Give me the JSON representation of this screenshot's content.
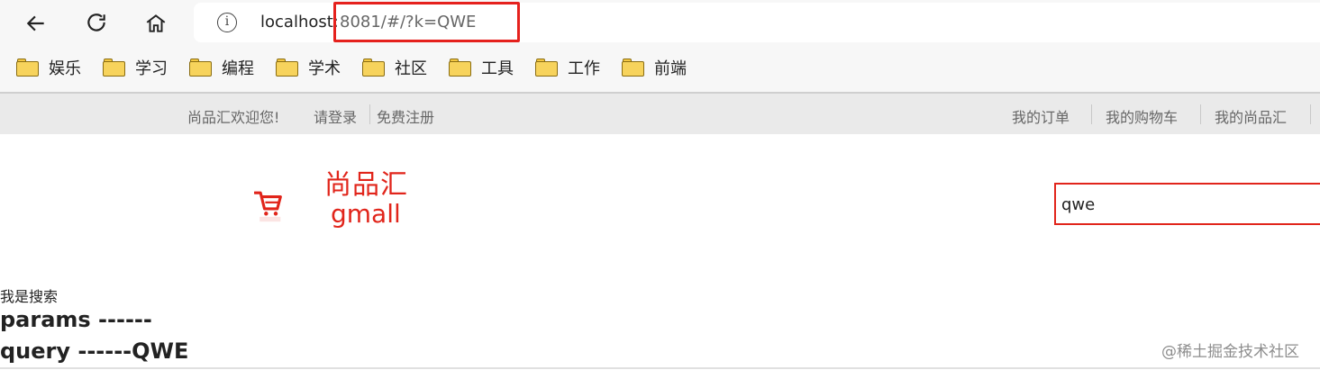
{
  "browser": {
    "url_host": "localhost:",
    "url_rest": "8081/#/?k=QWE",
    "bookmarks": [
      {
        "label": "娱乐",
        "icon": "folder-icon"
      },
      {
        "label": "学习",
        "icon": "folder-icon"
      },
      {
        "label": "编程",
        "icon": "folder-icon"
      },
      {
        "label": "学术",
        "icon": "folder-icon"
      },
      {
        "label": "社区",
        "icon": "folder-icon"
      },
      {
        "label": "工具",
        "icon": "folder-icon"
      },
      {
        "label": "工作",
        "icon": "folder-icon"
      },
      {
        "label": "前端",
        "icon": "folder-icon"
      }
    ],
    "highlight_color": "#e5211d"
  },
  "topbar": {
    "welcome": "尚品汇欢迎您!",
    "login": "请登录",
    "register": "免费注册",
    "nav": [
      "我的订单",
      "我的购物车",
      "我的尚品汇"
    ]
  },
  "logo": {
    "cn": "尚品汇",
    "en": "gmall",
    "color": "#e1251b"
  },
  "search": {
    "value": "qwe"
  },
  "content": {
    "title": "我是搜索",
    "params_line": "params ------",
    "query_line": "query ------QWE"
  },
  "watermark": "@稀土掘金技术社区"
}
